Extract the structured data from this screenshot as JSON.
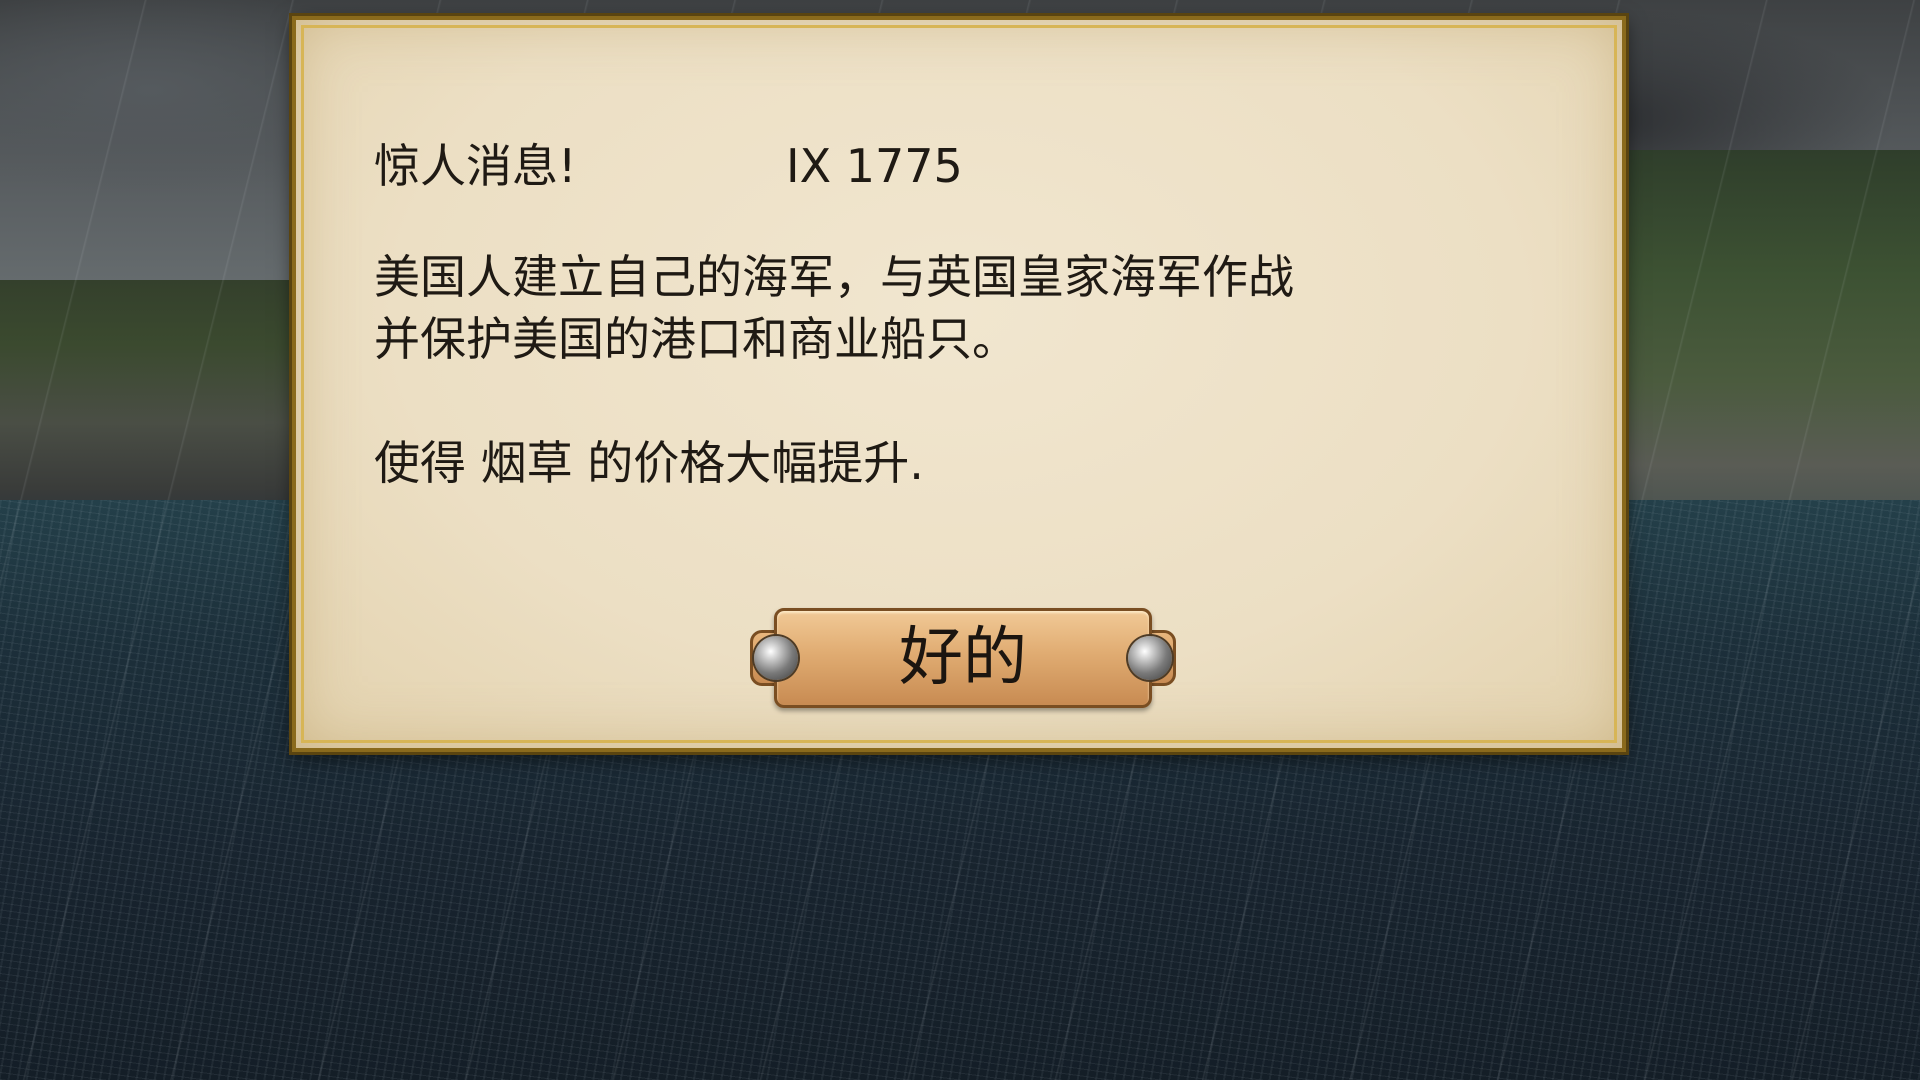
{
  "dialog": {
    "headline": "惊人消息!",
    "date": "IX 1775",
    "body_line1": "美国人建立自己的海军，与英国皇家海军作战",
    "body_line2": "并保护美国的港口和商业船只。",
    "effect": "使得 烟草 的价格大幅提升.",
    "ok_label": "好的"
  },
  "colors": {
    "parchment": "#ecdfc4",
    "frame_gold": "#d7b556",
    "button_brass": "#e0ac72",
    "text": "#1f1a14"
  },
  "icons": {
    "button_rivets": "metal-rivet-icon"
  }
}
